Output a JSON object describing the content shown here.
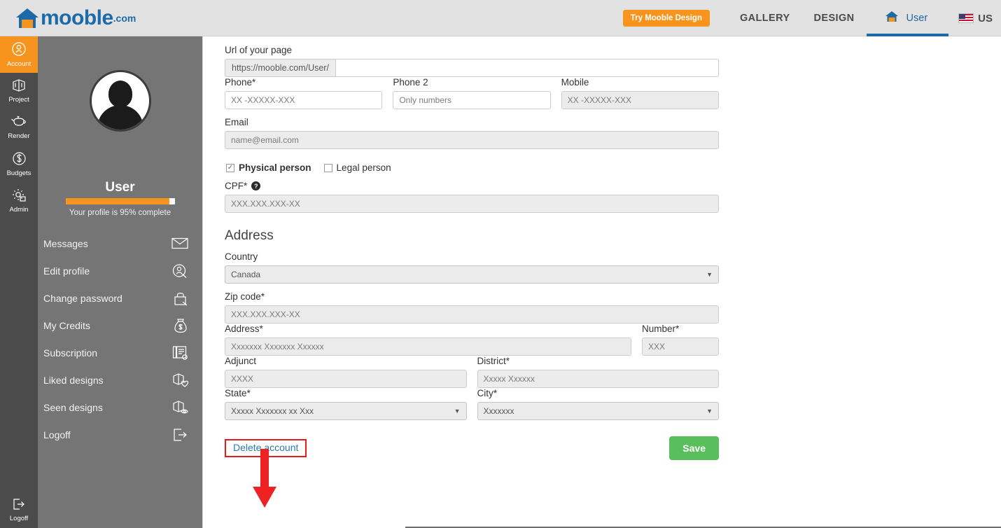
{
  "header": {
    "logo_text": "mooble",
    "logo_suffix": ".com",
    "logo_icon": "house-icon",
    "try_button": "Try Mooble Design",
    "nav": [
      {
        "label": "GALLERY",
        "name": "nav-gallery"
      },
      {
        "label": "DESIGN",
        "name": "nav-design"
      }
    ],
    "user_tab": {
      "label": "User",
      "icon": "house-icon",
      "active": true
    },
    "language": {
      "label": "US",
      "icon": "us-flag-icon"
    }
  },
  "rail": {
    "items": [
      {
        "label": "Account",
        "icon": "person-circle-icon",
        "active": true
      },
      {
        "label": "Project",
        "icon": "cube-project-icon",
        "active": false
      },
      {
        "label": "Render",
        "icon": "teapot-icon",
        "active": false
      },
      {
        "label": "Budgets",
        "icon": "dollar-circle-icon",
        "active": false
      },
      {
        "label": "Admin",
        "icon": "gear-icon",
        "active": false
      }
    ],
    "logoff": {
      "label": "Logoff",
      "icon": "logout-icon"
    }
  },
  "sidebar": {
    "avatar_icon": "user-avatar-icon",
    "user_name": "User",
    "progress_percent": 95,
    "progress_text": "Your profile is 95% complete",
    "items": [
      {
        "label": "Messages",
        "icon": "envelope-icon"
      },
      {
        "label": "Edit profile",
        "icon": "profile-edit-icon"
      },
      {
        "label": "Change password",
        "icon": "lock-icon"
      },
      {
        "label": "My Credits",
        "icon": "money-bag-icon"
      },
      {
        "label": "Subscription",
        "icon": "subscription-icon"
      },
      {
        "label": "Liked designs",
        "icon": "design-heart-icon"
      },
      {
        "label": "Seen designs",
        "icon": "design-eye-icon"
      },
      {
        "label": "Logoff",
        "icon": "logout-icon"
      }
    ]
  },
  "form": {
    "url": {
      "label": "Url of your page",
      "prefix": "https://mooble.com/User/",
      "value": "",
      "placeholder": ""
    },
    "phone": {
      "label": "Phone*",
      "placeholder": "XX -XXXXX-XXX",
      "value": ""
    },
    "phone2": {
      "label": "Phone 2",
      "placeholder": "Only numbers",
      "value": ""
    },
    "mobile": {
      "label": "Mobile",
      "placeholder": "XX -XXXXX-XXX",
      "value": ""
    },
    "email": {
      "label": "Email",
      "placeholder": "name@email.com",
      "value": ""
    },
    "person_type": {
      "physical": {
        "label": "Physical person",
        "checked": true
      },
      "legal": {
        "label": "Legal person",
        "checked": false
      }
    },
    "cpf": {
      "label": "CPF*",
      "help_icon": "question-mark-icon",
      "placeholder": "XXX.XXX.XXX-XX",
      "value": ""
    },
    "address_section_title": "Address",
    "country": {
      "label": "Country",
      "value": "Canada"
    },
    "zip": {
      "label": "Zip code*",
      "placeholder": "XXX.XXX.XXX-XX",
      "value": ""
    },
    "address": {
      "label": "Address*",
      "placeholder": "Xxxxxxx Xxxxxxx Xxxxxx",
      "value": ""
    },
    "number": {
      "label": "Number*",
      "placeholder": "XXX",
      "value": ""
    },
    "adjunct": {
      "label": "Adjunct",
      "placeholder": "XXXX",
      "value": ""
    },
    "district": {
      "label": "District*",
      "placeholder": "Xxxxx Xxxxxx",
      "value": ""
    },
    "state": {
      "label": "State*",
      "value": "Xxxxx Xxxxxxx xx Xxx"
    },
    "city": {
      "label": "City*",
      "value": "Xxxxxxx"
    },
    "delete_account": "Delete account",
    "save": "Save"
  },
  "annotation": {
    "arrow_color": "#ee2222",
    "highlight_color": "#e81b1b",
    "target": "Delete account"
  },
  "colors": {
    "brand_blue": "#1c6aa8",
    "accent_orange": "#f7941e",
    "save_green": "#58bf5c",
    "rail_dark": "#4b4b4b",
    "sidebar_gray": "#757575",
    "header_gray": "#e2e2e2"
  }
}
